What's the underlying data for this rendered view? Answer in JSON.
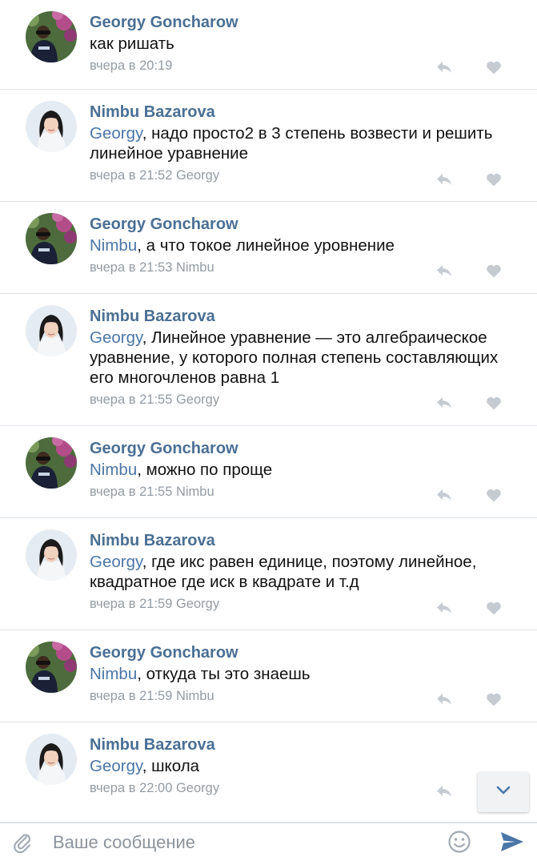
{
  "comments": [
    {
      "author": "Georgy Goncharow",
      "mention": "",
      "text": "как ришать",
      "time": "вчера в 20:19",
      "reply_to": "",
      "avatar": "georgy-avatar"
    },
    {
      "author": "Nimbu Bazarova",
      "mention": "Georgy",
      "text": ", надо просто2 в 3 степень возвести и решить линейное уравнение",
      "time": "вчера в 21:52",
      "reply_to": "Georgy",
      "avatar": "nimbu-avatar"
    },
    {
      "author": "Georgy Goncharow",
      "mention": "Nimbu",
      "text": ", а что токое линейное уровнение",
      "time": "вчера в 21:53",
      "reply_to": "Nimbu",
      "avatar": "georgy-avatar"
    },
    {
      "author": "Nimbu Bazarova",
      "mention": "Georgy",
      "text": ", Линейное уравнение — это алгебраическое уравнение, у которого полная степень составляющих его многочленов равна 1",
      "time": "вчера в 21:55",
      "reply_to": "Georgy",
      "avatar": "nimbu-avatar"
    },
    {
      "author": "Georgy Goncharow",
      "mention": "Nimbu",
      "text": ", можно по проще",
      "time": "вчера в 21:55",
      "reply_to": "Nimbu",
      "avatar": "georgy-avatar"
    },
    {
      "author": "Nimbu Bazarova",
      "mention": "Georgy",
      "text": ", где икс равен единице, поэтому линейное, квадратное где иск в квадрате и т.д",
      "time": "вчера в 21:59",
      "reply_to": "Georgy",
      "avatar": "nimbu-avatar"
    },
    {
      "author": "Georgy Goncharow",
      "mention": "Nimbu",
      "text": ", откуда ты это знаешь",
      "time": "вчера в 21:59",
      "reply_to": "Nimbu",
      "avatar": "georgy-avatar"
    },
    {
      "author": "Nimbu Bazarova",
      "mention": "Georgy",
      "text": ", школа",
      "time": "вчера в 22:00",
      "reply_to": "Georgy",
      "avatar": "nimbu-avatar"
    }
  ],
  "composer": {
    "placeholder": "Ваше сообщение"
  },
  "icons": {
    "reply": "reply-icon",
    "like": "heart-icon",
    "attach": "paperclip-icon",
    "emoji": "smiley-icon",
    "send": "send-icon",
    "scroll": "chevron-down-icon"
  },
  "colors": {
    "author": "#4a6f94",
    "mention": "#4a76a8",
    "meta": "#939ba3",
    "icon": "#c5cbd1",
    "send": "#4a76a8"
  }
}
